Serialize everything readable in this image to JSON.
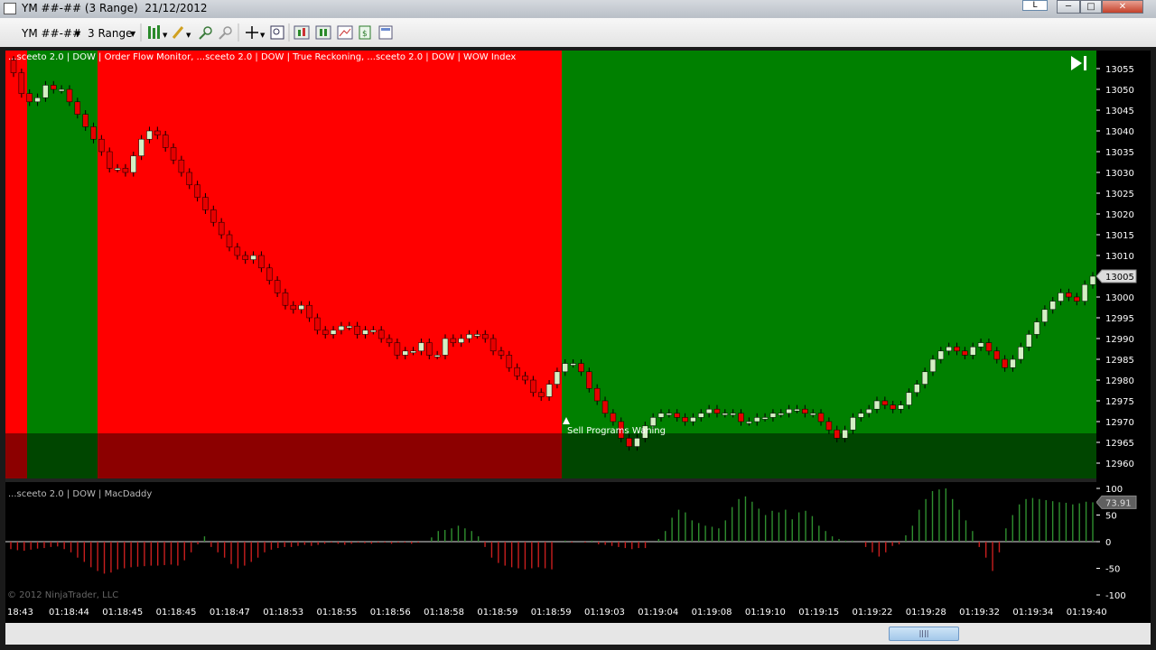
{
  "window": {
    "title": "YM ##-## (3 Range)  21/12/2012",
    "extra_btn": "L",
    "min": "─",
    "max": "□",
    "close": "✕"
  },
  "toolbar": {
    "instrument": "YM ##-##",
    "interval": "3 Range",
    "icons": [
      "bar-style-icon",
      "draw-pencil-icon",
      "zoom-in-icon",
      "zoom-out-icon",
      "crosshair-icon",
      "data-box-icon",
      "indicators-icon",
      "strategies-icon",
      "properties-icon",
      "template-icon",
      "layout-icon"
    ]
  },
  "chart": {
    "indicator_label": "...sceeto 2.0 | DOW | Order Flow Monitor,  ...sceeto 2.0 | DOW | True Reckoning,  ...sceeto 2.0 | DOW | WOW Index",
    "annotation": "Sell Programs Waning",
    "current_price": "13005",
    "colors": {
      "red_zone": "#ff0000",
      "green_zone": "#008000",
      "up_candle": "#d4efc4",
      "down_candle": "#e60000"
    }
  },
  "price_axis": {
    "labels": [
      "13055",
      "13050",
      "13045",
      "13040",
      "13035",
      "13030",
      "13025",
      "13020",
      "13015",
      "13010",
      "13005",
      "13000",
      "12995",
      "12990",
      "12985",
      "12980",
      "12975",
      "12970",
      "12965",
      "12960"
    ]
  },
  "subpanel": {
    "label": "...sceeto 2.0 | DOW | MacDaddy",
    "current_value": "73.91",
    "axis_labels": [
      "100",
      "50",
      "0",
      "-50",
      "-100"
    ],
    "copyright": "© 2012 NinjaTrader, LLC",
    "colors": {
      "positive": "#2f8f2f",
      "negative": "#c81e1e"
    }
  },
  "time_axis": {
    "labels": [
      "18:43",
      "01:18:44",
      "01:18:45",
      "01:18:45",
      "01:18:47",
      "01:18:53",
      "01:18:55",
      "01:18:56",
      "01:18:58",
      "01:18:59",
      "01:18:59",
      "01:19:03",
      "01:19:04",
      "01:19:08",
      "01:19:10",
      "01:19:15",
      "01:19:22",
      "01:19:28",
      "01:19:32",
      "01:19:34",
      "01:19:40"
    ]
  },
  "chart_data": {
    "type": "candlestick",
    "ylim": [
      12958,
      13058
    ],
    "close": [
      13054,
      13049,
      13047,
      13048,
      13051,
      13050,
      13050,
      13047,
      13044,
      13041,
      13038,
      13035,
      13031,
      13031,
      13030,
      13034,
      13038,
      13040,
      13039,
      13036,
      13033,
      13030,
      13027,
      13024,
      13021,
      13018,
      13015,
      13012,
      13010,
      13009,
      13010,
      13007,
      13004,
      13001,
      12998,
      12997,
      12998,
      12995,
      12992,
      12991,
      12992,
      12993,
      12993,
      12991,
      12992,
      12992,
      12990,
      12989,
      12986,
      12987,
      12987,
      12989,
      12986,
      12986,
      12990,
      12989,
      12990,
      12991,
      12991,
      12990,
      12987,
      12986,
      12983,
      12981,
      12980,
      12977,
      12976,
      12979,
      12982,
      12984,
      12984,
      12982,
      12978,
      12975,
      12972,
      12970,
      12966,
      12964,
      12966,
      12969,
      12971,
      12972,
      12972,
      12971,
      12970,
      12971,
      12972,
      12973,
      12972,
      12972,
      12972,
      12970,
      12970,
      12971,
      12971,
      12972,
      12972,
      12973,
      12973,
      12972,
      12972,
      12970,
      12968,
      12966,
      12968,
      12971,
      12972,
      12973,
      12975,
      12974,
      12973,
      12974,
      12977,
      12979,
      12982,
      12985,
      12987,
      12988,
      12987,
      12986,
      12988,
      12989,
      12987,
      12985,
      12983,
      12985,
      12988,
      12991,
      12994,
      12997,
      12999,
      13001,
      13000,
      12999,
      13003,
      13005
    ]
  },
  "macd_data": [
    -14,
    -16,
    -17,
    -15,
    -13,
    -12,
    -10,
    -9,
    -14,
    -20,
    -30,
    -38,
    -48,
    -55,
    -60,
    -58,
    -52,
    -50,
    -48,
    -47,
    -46,
    -45,
    -45,
    -44,
    -43,
    -45,
    -35,
    -20,
    -5,
    10,
    -10,
    -20,
    -30,
    -42,
    -50,
    -45,
    -38,
    -30,
    -20,
    -15,
    -12,
    -10,
    -10,
    -8,
    -6,
    -8,
    -6,
    -4,
    -2,
    -4,
    -6,
    -4,
    -2,
    -3,
    -4,
    -2,
    -2,
    -4,
    -2,
    -2,
    -4,
    -2,
    0,
    8,
    20,
    22,
    25,
    30,
    25,
    20,
    10,
    -10,
    -30,
    -40,
    -45,
    -48,
    -50,
    -52,
    -50,
    -48,
    -50,
    -52,
    0,
    2,
    -2,
    0,
    -2,
    2,
    -5,
    -6,
    -8,
    -10,
    -12,
    -14,
    -12,
    -12,
    0,
    5,
    20,
    45,
    60,
    55,
    40,
    35,
    30,
    28,
    25,
    40,
    65,
    80,
    85,
    75,
    62,
    50,
    58,
    55,
    60,
    42,
    55,
    58,
    48,
    30,
    20,
    10,
    5,
    2,
    2,
    0,
    -10,
    -20,
    -28,
    -20,
    -8,
    -5,
    12,
    30,
    60,
    80,
    95,
    98,
    100,
    80,
    60,
    40,
    20,
    -10,
    -30,
    -55,
    -20,
    25,
    50,
    70,
    80,
    82,
    80,
    78,
    76,
    74,
    73,
    70,
    72,
    75,
    73.91
  ]
}
